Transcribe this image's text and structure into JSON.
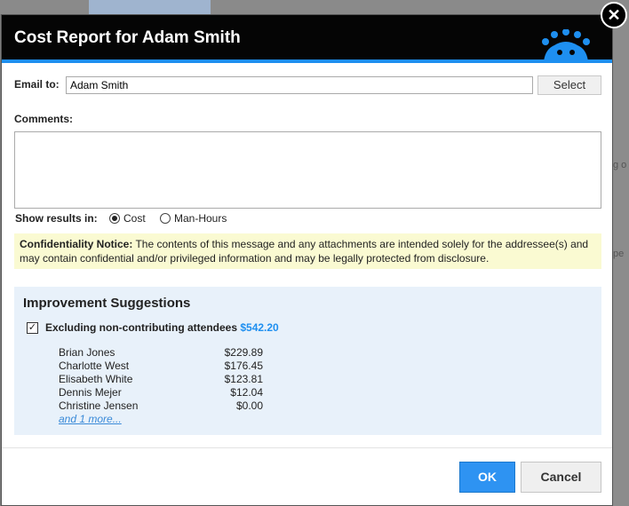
{
  "dialog": {
    "title": "Cost Report for Adam Smith",
    "close_symbol": "✕"
  },
  "email": {
    "label": "Email to:",
    "value": "Adam Smith",
    "select_label": "Select"
  },
  "comments": {
    "label": "Comments:",
    "value": ""
  },
  "results": {
    "label": "Show results in:",
    "options": [
      {
        "label": "Cost",
        "selected": true
      },
      {
        "label": "Man-Hours",
        "selected": false
      }
    ]
  },
  "notice": {
    "heading": "Confidentiality Notice:",
    "text": " The contents of this message and any attachments are intended solely for the addressee(s) and may contain confidential and/or privileged information and may be legally protected from disclosure."
  },
  "improvements": {
    "title": "Improvement Suggestions",
    "exclude_label": "Excluding non-contributing attendees",
    "exclude_checked": true,
    "exclude_amount": "$542.20",
    "attendees": [
      {
        "name": "Brian Jones",
        "amount": "$229.89"
      },
      {
        "name": "Charlotte West",
        "amount": "$176.45"
      },
      {
        "name": "Elisabeth White",
        "amount": "$123.81"
      },
      {
        "name": "Dennis Mejer",
        "amount": "$12.04"
      },
      {
        "name": "Christine Jensen",
        "amount": "$0.00"
      }
    ],
    "more_link": "and 1 more..."
  },
  "buttons": {
    "ok": "OK",
    "cancel": "Cancel"
  },
  "background": {
    "fragment_1": "g o",
    "fragment_2": "pe"
  },
  "colors": {
    "title_bar": "#050505",
    "accent": "#1e8ff0",
    "notice_bg": "#fafad2",
    "suggestions_bg": "#e8f1fa"
  }
}
